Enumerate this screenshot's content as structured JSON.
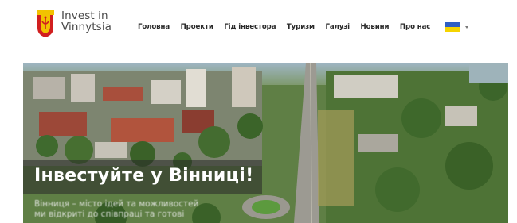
{
  "logo": {
    "line1": "Invest in",
    "line2": "Vinnytsia",
    "icon": "vinnytsia-crest-icon"
  },
  "nav": {
    "items": [
      {
        "label": "Головна",
        "name": "nav-item-home"
      },
      {
        "label": "Проекти",
        "name": "nav-item-projects"
      },
      {
        "label": "Гід інвестора",
        "name": "nav-item-investor-guide"
      },
      {
        "label": "Туризм",
        "name": "nav-item-tourism"
      },
      {
        "label": "Галузі",
        "name": "nav-item-industries"
      },
      {
        "label": "Новини",
        "name": "nav-item-news"
      },
      {
        "label": "Про нас",
        "name": "nav-item-about"
      }
    ],
    "language_icon": "ukraine-flag-icon"
  },
  "hero": {
    "title": "Інвестуйте у Вінниці!",
    "subtitle_line1": "Вінниця – місто ідей та можливостей",
    "subtitle_line2": "ми відкриті до співпраці та готові"
  },
  "colors": {
    "flag_blue": "#2f5fc4",
    "flag_yellow": "#f5d400",
    "crest_red": "#d11f1f",
    "crest_gold": "#f2c200"
  }
}
